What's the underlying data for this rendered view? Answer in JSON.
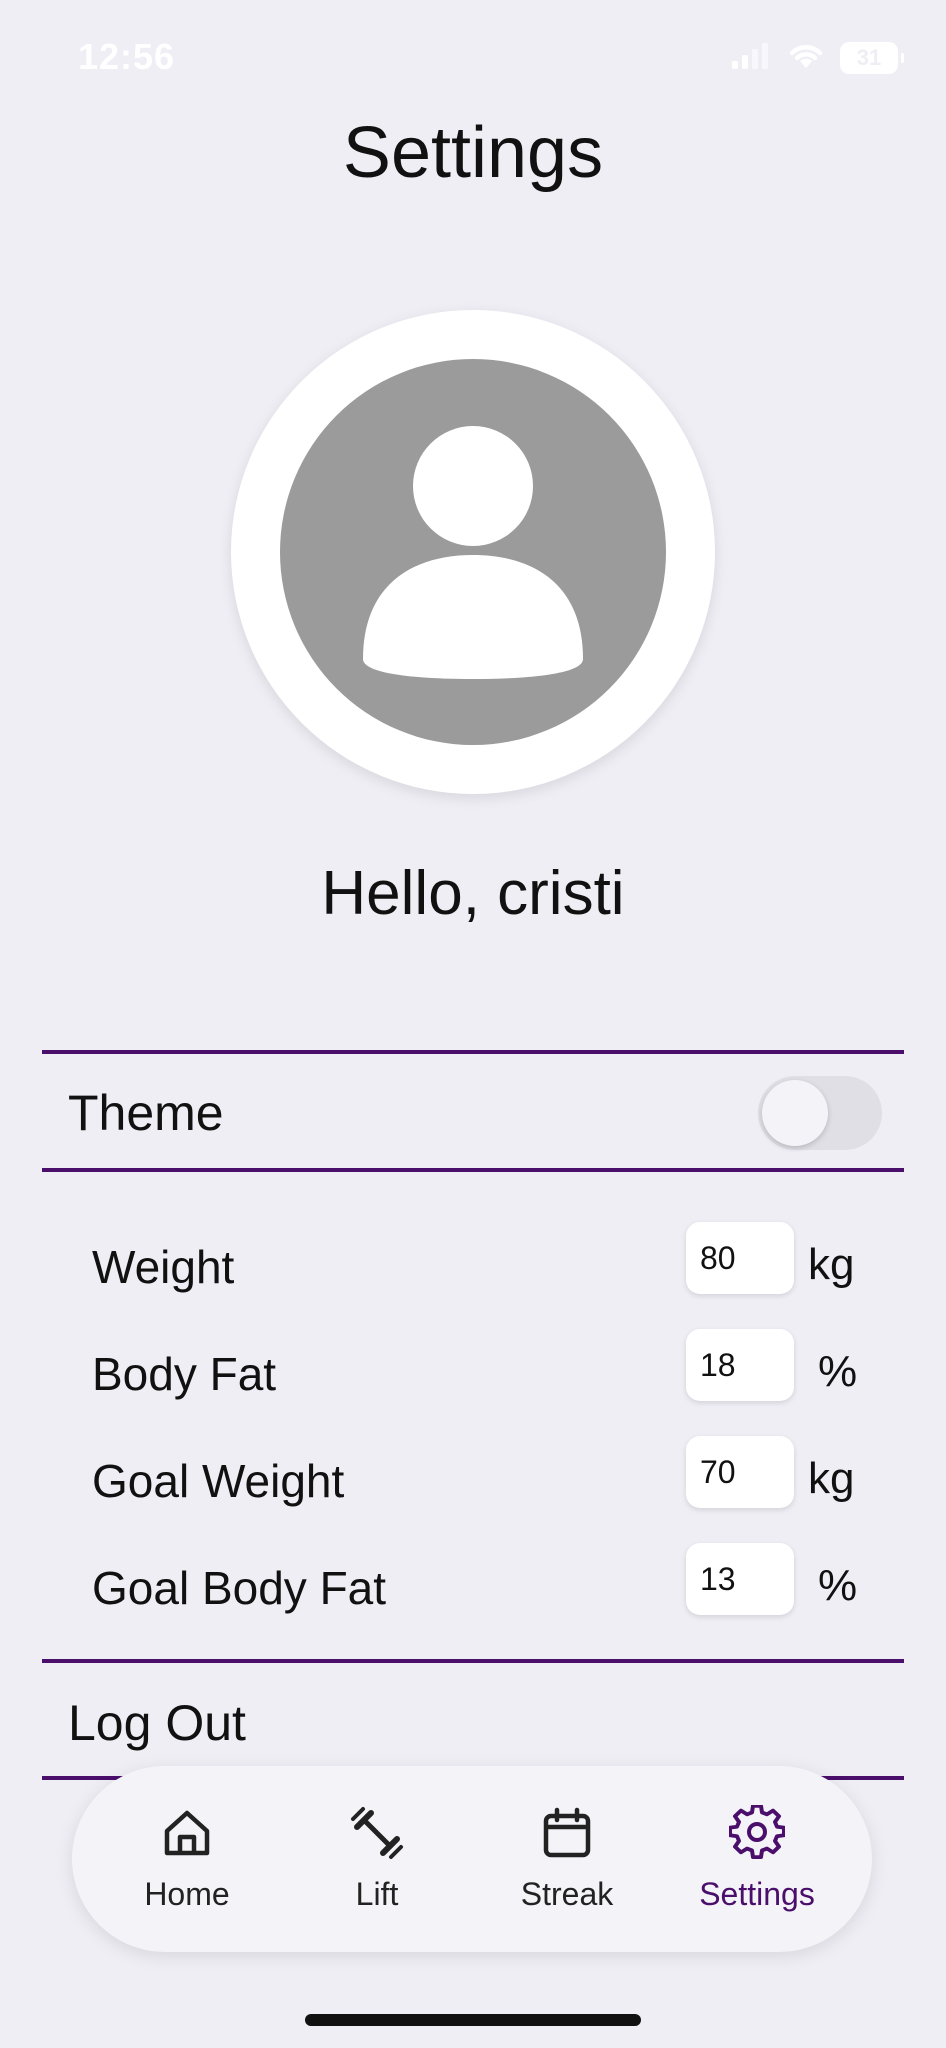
{
  "status_bar": {
    "time": "12:56",
    "battery": "31"
  },
  "header": {
    "title": "Settings"
  },
  "profile": {
    "greeting": "Hello, cristi",
    "avatar_icon": "person-icon"
  },
  "theme": {
    "label": "Theme",
    "enabled": false
  },
  "stats": [
    {
      "label": "Weight",
      "value": "80",
      "unit": "kg"
    },
    {
      "label": "Body Fat",
      "value": "18",
      "unit": "%"
    },
    {
      "label": "Goal Weight",
      "value": "70",
      "unit": "kg"
    },
    {
      "label": "Goal Body Fat",
      "value": "13",
      "unit": "%"
    }
  ],
  "logout": {
    "label": "Log Out"
  },
  "tabs": [
    {
      "label": "Home",
      "icon": "home-icon",
      "active": false
    },
    {
      "label": "Lift",
      "icon": "dumbbell-icon",
      "active": false
    },
    {
      "label": "Streak",
      "icon": "calendar-icon",
      "active": false
    },
    {
      "label": "Settings",
      "icon": "gear-icon",
      "active": true
    }
  ],
  "colors": {
    "accent": "#4a0e6b",
    "background": "#efeef5",
    "avatar_gray": "#9b9b9b"
  }
}
